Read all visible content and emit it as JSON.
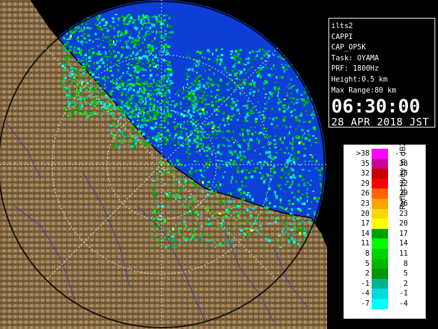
{
  "info": {
    "station": "ilts2",
    "product": "CAPPI",
    "config": "CAP_OP5K",
    "task": "Task: OYAMA",
    "prf": "PRF: 1800Hz",
    "height": "Height:0.5 km",
    "max_range": "Max Range:80 km",
    "time": "06:30:00",
    "date": "28 APR 2018 JST"
  },
  "colors": {
    "ocean": "#0d3fd6",
    "land_dark": "#6d5234",
    "land_light": "#a88e62",
    "rings": "#ffffff",
    "coast": "#000000",
    "rivers": "#3b3bb0"
  },
  "icons": [
    "radar-display",
    "range-ring",
    "coastline",
    "river-lines"
  ],
  "scale": {
    "title": "Reflectivity in dBZ",
    "rows": [
      {
        "lo": ">38",
        "hi": "---",
        "color": "#ff00ff"
      },
      {
        "lo": "35",
        "hi": "38",
        "color": "#c8009a"
      },
      {
        "lo": "32",
        "hi": "35",
        "color": "#c80000"
      },
      {
        "lo": "29",
        "hi": "32",
        "color": "#ff0000"
      },
      {
        "lo": "26",
        "hi": "29",
        "color": "#ff6400"
      },
      {
        "lo": "23",
        "hi": "26",
        "color": "#ffa500"
      },
      {
        "lo": "20",
        "hi": "23",
        "color": "#ffd700"
      },
      {
        "lo": "17",
        "hi": "20",
        "color": "#ffff00"
      },
      {
        "lo": "14",
        "hi": "17",
        "color": "#00a000"
      },
      {
        "lo": "11",
        "hi": "14",
        "color": "#00ff00"
      },
      {
        "lo": "8",
        "hi": "11",
        "color": "#00d200"
      },
      {
        "lo": "5",
        "hi": "8",
        "color": "#00b400"
      },
      {
        "lo": "2",
        "hi": "5",
        "color": "#009600"
      },
      {
        "lo": "-1",
        "hi": "2",
        "color": "#00b48c"
      },
      {
        "lo": "-4",
        "hi": "-1",
        "color": "#00dcdc"
      },
      {
        "lo": "-7",
        "hi": "-4",
        "color": "#00ffff"
      }
    ]
  }
}
